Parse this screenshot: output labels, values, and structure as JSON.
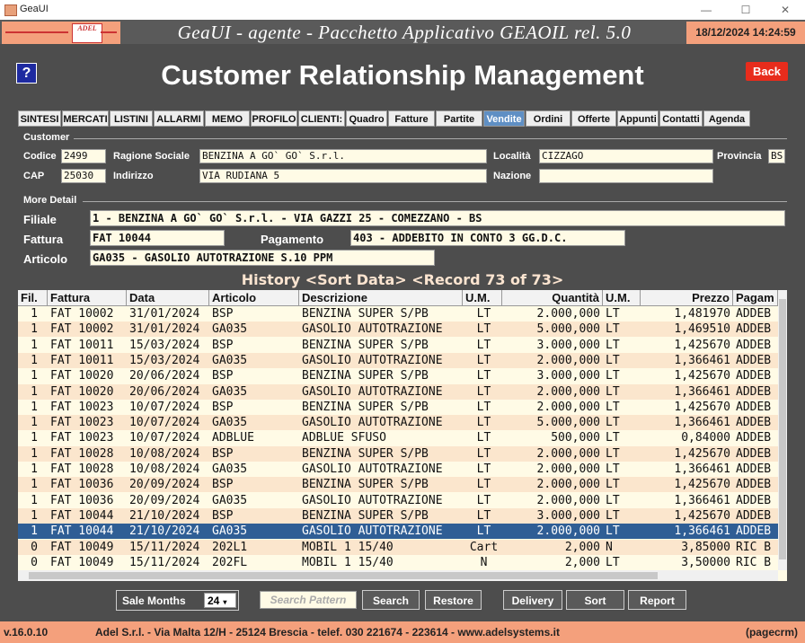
{
  "window": {
    "title": "GeaUI",
    "minimize": "—",
    "maximize": "☐",
    "close": "✕"
  },
  "header": {
    "logo_text": "ADEL",
    "app_title": "GeaUI - agente - Pacchetto Applicativo GEAOIL rel. 5.0",
    "datetime": "18/12/2024 14:24:59"
  },
  "page": {
    "help": "?",
    "title": "Customer Relationship Management",
    "back": "Back"
  },
  "tabs": [
    {
      "label": "SINTESI",
      "active": false
    },
    {
      "label": "MERCATI",
      "active": false
    },
    {
      "label": "LISTINI",
      "active": false
    },
    {
      "label": "ALLARMI",
      "active": false
    },
    {
      "label": "MEMO",
      "active": false
    },
    {
      "label": "PROFILO",
      "active": false
    },
    {
      "label": "CLIENTI:",
      "active": false
    },
    {
      "label": "Quadro",
      "active": false
    },
    {
      "label": "Fatture",
      "active": false
    },
    {
      "label": "Partite",
      "active": false
    },
    {
      "label": "Vendite",
      "active": true
    },
    {
      "label": "Ordini",
      "active": false
    },
    {
      "label": "Offerte",
      "active": false
    },
    {
      "label": "Appunti",
      "active": false
    },
    {
      "label": "Contatti",
      "active": false
    },
    {
      "label": "Agenda",
      "active": false
    }
  ],
  "customer": {
    "section": "Customer",
    "codice_label": "Codice",
    "codice": "2499",
    "ragione_label": "Ragione Sociale",
    "ragione": "BENZINA A GO` GO` S.r.l.",
    "localita_label": "Località",
    "localita": "CIZZAGO",
    "provincia_label": "Provincia",
    "provincia": "BS",
    "cap_label": "CAP",
    "cap": "25030",
    "indirizzo_label": "Indirizzo",
    "indirizzo": "VIA RUDIANA 5",
    "nazione_label": "Nazione",
    "nazione": ""
  },
  "detail": {
    "section": "More Detail",
    "filiale_label": "Filiale",
    "filiale": "1 - BENZINA A GO` GO` S.r.l. - VIA GAZZI 25 - COMEZZANO - BS",
    "fattura_label": "Fattura",
    "fattura": "FAT 10044",
    "pagamento_label": "Pagamento",
    "pagamento": "403 - ADDEBITO IN CONTO 3 GG.D.C.",
    "articolo_label": "Articolo",
    "articolo": "GA035  - GASOLIO AUTOTRAZIONE S.10 PPM"
  },
  "history": {
    "title": "History <Sort Data> <Record 73 of  73>",
    "columns": [
      "Fil.",
      "Fattura",
      "Data",
      "Articolo",
      "Descrizione",
      "U.M.",
      "Quantità",
      "U.M.",
      "Prezzo",
      "Pagam"
    ],
    "rows": [
      [
        "1",
        "FAT 10002",
        "31/01/2024",
        "BSP",
        "BENZINA SUPER S/PB",
        "LT",
        "2.000,000",
        "LT",
        "1,481970",
        "ADDEB"
      ],
      [
        "1",
        "FAT 10002",
        "31/01/2024",
        "GA035",
        "GASOLIO AUTOTRAZIONE",
        "LT",
        "5.000,000",
        "LT",
        "1,469510",
        "ADDEB"
      ],
      [
        "1",
        "FAT 10011",
        "15/03/2024",
        "BSP",
        "BENZINA SUPER S/PB",
        "LT",
        "3.000,000",
        "LT",
        "1,425670",
        "ADDEB"
      ],
      [
        "1",
        "FAT 10011",
        "15/03/2024",
        "GA035",
        "GASOLIO AUTOTRAZIONE",
        "LT",
        "2.000,000",
        "LT",
        "1,366461",
        "ADDEB"
      ],
      [
        "1",
        "FAT 10020",
        "20/06/2024",
        "BSP",
        "BENZINA SUPER S/PB",
        "LT",
        "3.000,000",
        "LT",
        "1,425670",
        "ADDEB"
      ],
      [
        "1",
        "FAT 10020",
        "20/06/2024",
        "GA035",
        "GASOLIO AUTOTRAZIONE",
        "LT",
        "2.000,000",
        "LT",
        "1,366461",
        "ADDEB"
      ],
      [
        "1",
        "FAT 10023",
        "10/07/2024",
        "BSP",
        "BENZINA SUPER S/PB",
        "LT",
        "2.000,000",
        "LT",
        "1,425670",
        "ADDEB"
      ],
      [
        "1",
        "FAT 10023",
        "10/07/2024",
        "GA035",
        "GASOLIO AUTOTRAZIONE",
        "LT",
        "5.000,000",
        "LT",
        "1,366461",
        "ADDEB"
      ],
      [
        "1",
        "FAT 10023",
        "10/07/2024",
        "ADBLUE",
        "ADBLUE SFUSO",
        "LT",
        "500,000",
        "LT",
        "0,84000",
        "ADDEB"
      ],
      [
        "1",
        "FAT 10028",
        "10/08/2024",
        "BSP",
        "BENZINA SUPER S/PB",
        "LT",
        "2.000,000",
        "LT",
        "1,425670",
        "ADDEB"
      ],
      [
        "1",
        "FAT 10028",
        "10/08/2024",
        "GA035",
        "GASOLIO AUTOTRAZIONE",
        "LT",
        "2.000,000",
        "LT",
        "1,366461",
        "ADDEB"
      ],
      [
        "1",
        "FAT 10036",
        "20/09/2024",
        "BSP",
        "BENZINA SUPER S/PB",
        "LT",
        "2.000,000",
        "LT",
        "1,425670",
        "ADDEB"
      ],
      [
        "1",
        "FAT 10036",
        "20/09/2024",
        "GA035",
        "GASOLIO AUTOTRAZIONE",
        "LT",
        "2.000,000",
        "LT",
        "1,366461",
        "ADDEB"
      ],
      [
        "1",
        "FAT 10044",
        "21/10/2024",
        "BSP",
        "BENZINA SUPER S/PB",
        "LT",
        "3.000,000",
        "LT",
        "1,425670",
        "ADDEB"
      ],
      [
        "1",
        "FAT 10044",
        "21/10/2024",
        "GA035",
        "GASOLIO AUTOTRAZIONE",
        "LT",
        "2.000,000",
        "LT",
        "1,366461",
        "ADDEB"
      ],
      [
        "0",
        "FAT 10049",
        "15/11/2024",
        "202L1",
        "MOBIL 1 15/40",
        "Cart",
        "2,000",
        "N",
        "3,85000",
        "RIC B"
      ],
      [
        "0",
        "FAT 10049",
        "15/11/2024",
        "202FL",
        "MOBIL 1 15/40",
        "N",
        "2,000",
        "LT",
        "3,50000",
        "RIC B"
      ]
    ],
    "selected_row": 14
  },
  "toolbar": {
    "months_label": "Sale Months",
    "months_value": "24",
    "search_placeholder": "Search Pattern",
    "search": "Search",
    "restore": "Restore",
    "delivery": "Delivery",
    "sort": "Sort",
    "report": "Report"
  },
  "footer": {
    "version": "v.16.0.10",
    "address": "Adel S.r.l. - Via Malta 12/H - 25124 Brescia - telef. 030 221674 - 223614 - www.adelsystems.it",
    "code": "(pagecrm)"
  },
  "colors": {
    "accent": "#f4a07c",
    "selected_row": "#2f5e95",
    "back": "#e82c1c",
    "active_tab": "#5f8fc4"
  }
}
